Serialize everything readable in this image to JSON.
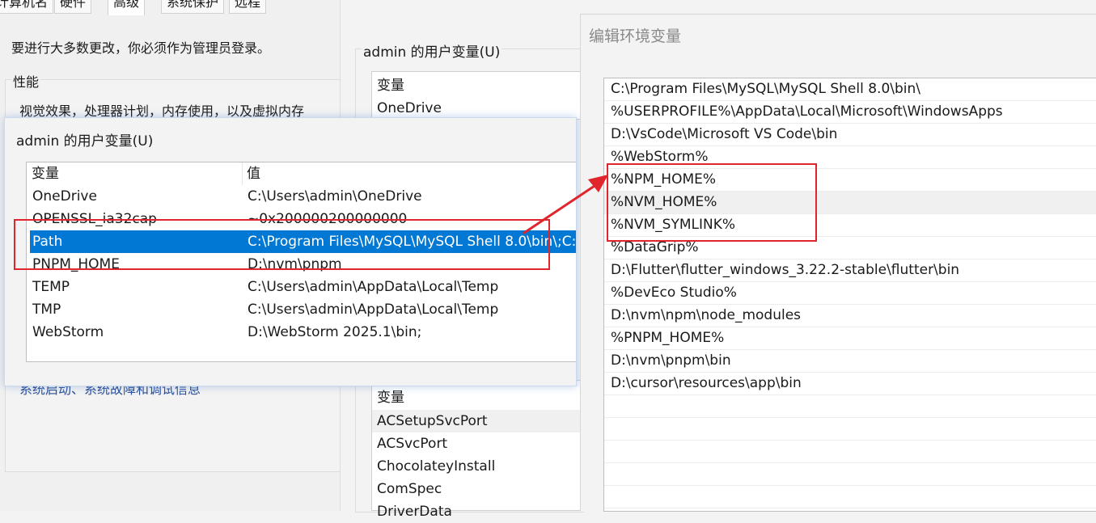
{
  "system_properties": {
    "tabs": [
      "计算机名",
      "硬件",
      "高级",
      "系统保护",
      "远程"
    ],
    "notice": "要进行大多数更改，你必须作为管理员登录。",
    "performance_label": "性能",
    "performance_desc": "视觉效果，处理器计划，内存使用，以及虚拟内存",
    "startup_desc": "系统启动、系统故障和调试信息"
  },
  "env_vars": {
    "user_group_label": "admin 的用户变量(U)",
    "user_col_variable": "变量",
    "user_first_row": "OneDrive",
    "system_col_variable": "变量",
    "system_rows": [
      "ACSetupSvcPort",
      "ACSvcPort",
      "ChocolateyInstall",
      "ComSpec",
      "DriverData"
    ]
  },
  "user_vars_popup": {
    "title": "admin 的用户变量(U)",
    "col_variable": "变量",
    "col_value": "值",
    "rows": [
      {
        "name": "OneDrive",
        "value": "C:\\Users\\admin\\OneDrive"
      },
      {
        "name": "OPENSSL_ia32cap",
        "value": "~0x200000200000000"
      },
      {
        "name": "Path",
        "value": "C:\\Program Files\\MySQL\\MySQL Shell 8.0\\bin\\;C:"
      },
      {
        "name": "PNPM_HOME",
        "value": "D:\\nvm\\pnpm"
      },
      {
        "name": "TEMP",
        "value": "C:\\Users\\admin\\AppData\\Local\\Temp"
      },
      {
        "name": "TMP",
        "value": "C:\\Users\\admin\\AppData\\Local\\Temp"
      },
      {
        "name": "WebStorm",
        "value": "D:\\WebStorm 2025.1\\bin;"
      }
    ],
    "selected_row": "Path"
  },
  "edit_dialog": {
    "title": "编辑环境变量",
    "entries": [
      "C:\\Program Files\\MySQL\\MySQL Shell 8.0\\bin\\",
      "%USERPROFILE%\\AppData\\Local\\Microsoft\\WindowsApps",
      "D:\\VsCode\\Microsoft VS Code\\bin",
      "%WebStorm%",
      "%NPM_HOME%",
      "%NVM_HOME%",
      "%NVM_SYMLINK%",
      "%DataGrip%",
      "D:\\Flutter\\flutter_windows_3.22.2-stable\\flutter\\bin",
      "%DevEco Studio%",
      "D:\\nvm\\npm\\node_modules",
      "%PNPM_HOME%",
      "D:\\nvm\\pnpm\\bin",
      "D:\\cursor\\resources\\app\\bin",
      "",
      "",
      "",
      "",
      ""
    ],
    "hovered_entry": "%NVM_HOME%"
  },
  "colors": {
    "selection": "#0078d4",
    "annotation": "#e0262c"
  }
}
